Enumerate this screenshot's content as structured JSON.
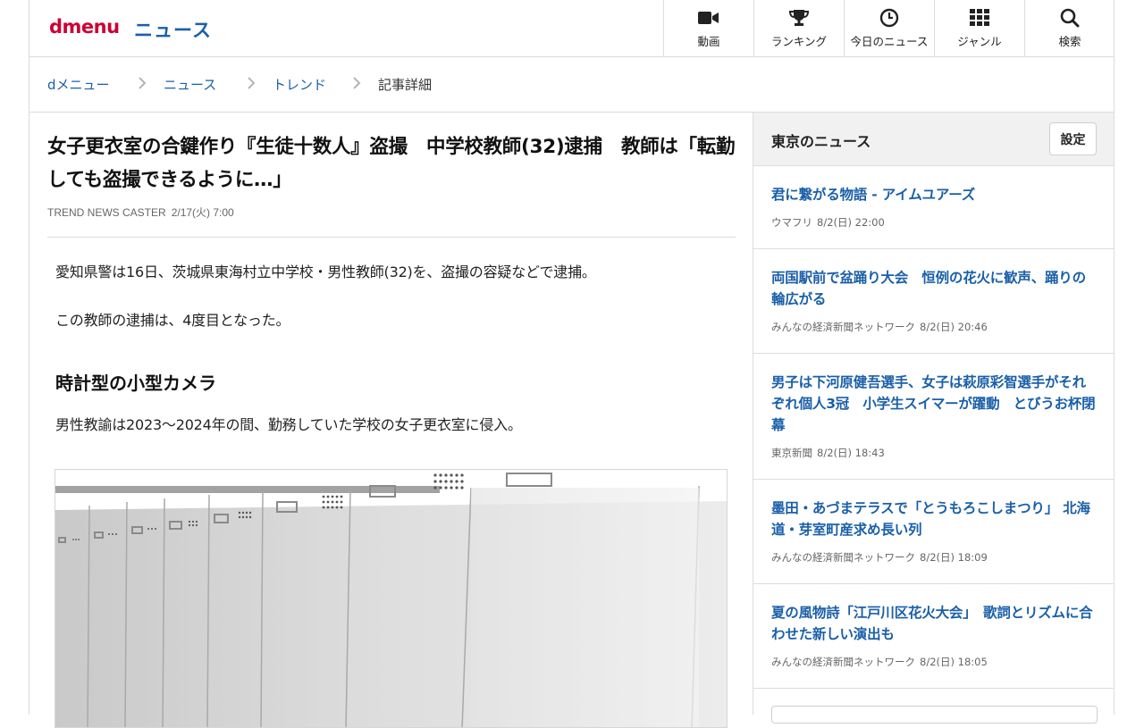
{
  "header": {
    "logo": "dmenu",
    "section": "ニュース",
    "nav": [
      {
        "label": "動画",
        "icon": "video-camera-icon"
      },
      {
        "label": "ランキング",
        "icon": "trophy-icon"
      },
      {
        "label": "今日のニュース",
        "icon": "clock-icon"
      },
      {
        "label": "ジャンル",
        "icon": "grid-icon"
      },
      {
        "label": "検索",
        "icon": "search-icon"
      }
    ]
  },
  "breadcrumb": {
    "items": [
      "dメニュー",
      "ニュース",
      "トレンド"
    ],
    "current": "記事詳細"
  },
  "article": {
    "title": "女子更衣室の合鍵作り『生徒十数人』盗撮　中学校教師(32)逮捕　教師は「転勤しても盗撮できるように…」",
    "source": "TREND NEWS CASTER",
    "date": "2/17(火) 7:00",
    "paragraphs": [
      "愛知県警は16日、茨城県東海村立中学校・男性教師(32)を、盗撮の容疑などで逮捕。",
      "この教師の逮捕は、4度目となった。",
      "男性教諭は2023〜2024年の間、勤務していた学校の女子更衣室に侵入。"
    ],
    "subheading": "時計型の小型カメラ"
  },
  "sidebar": {
    "title": "東京のニュース",
    "settings_label": "設定",
    "news": [
      {
        "title": "君に繋がる物語 - アイムユアーズ",
        "source": "ウマフリ",
        "datetime": "8/2(日) 22:00"
      },
      {
        "title": "両国駅前で盆踊り大会　恒例の花火に歓声、踊りの輪広がる",
        "source": "みんなの経済新聞ネットワーク",
        "datetime": "8/2(日) 20:46"
      },
      {
        "title": "男子は下河原健吾選手、女子は萩原彩智選手がそれぞれ個人3冠　小学生スイマーが躍動　とびうお杯閉幕",
        "source": "東京新聞",
        "datetime": "8/2(日) 18:43"
      },
      {
        "title": "墨田・あづまテラスで「とうもろこしまつり」 北海道・芽室町産求め長い列",
        "source": "みんなの経済新聞ネットワーク",
        "datetime": "8/2(日) 18:09"
      },
      {
        "title": "夏の風物詩「江戸川区花火大会」　歌詞とリズムに合わせた新しい演出も",
        "source": "みんなの経済新聞ネットワーク",
        "datetime": "8/2(日) 18:05"
      }
    ]
  },
  "colors": {
    "brand_red": "#cc0033",
    "link_blue": "#1a5fa8",
    "border": "#dcdcdc",
    "sidebar_header_bg": "#f1f1f1"
  }
}
